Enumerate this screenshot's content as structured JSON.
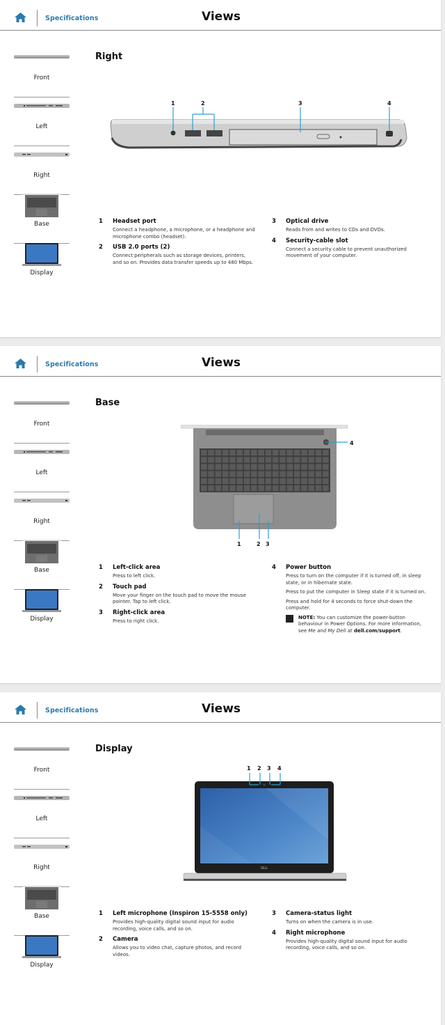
{
  "header": {
    "breadcrumb": "Specifications",
    "title": "Views",
    "home_icon": "home-icon",
    "accent_color": "#2a7bab"
  },
  "sidebar": {
    "items": [
      {
        "label": "Front",
        "thumb": "front-view-thumbnail"
      },
      {
        "label": "Left",
        "thumb": "left-view-thumbnail"
      },
      {
        "label": "Right",
        "thumb": "right-view-thumbnail"
      },
      {
        "label": "Base",
        "thumb": "base-view-thumbnail"
      },
      {
        "label": "Display",
        "thumb": "display-view-thumbnail"
      }
    ]
  },
  "pages": [
    {
      "section": "Right",
      "callouts": [
        "1",
        "2",
        "3",
        "4"
      ],
      "entries": [
        {
          "num": "1",
          "name": "Headset port",
          "desc": [
            "Connect a headphone, a microphone, or a headphone and microphone combo (headset)."
          ]
        },
        {
          "num": "2",
          "name": "USB 2.0 ports (2)",
          "desc": [
            "Connect peripherals such as storage devices, printers, and so on. Provides data transfer speeds up to 480 Mbps."
          ]
        },
        {
          "num": "3",
          "name": "Optical drive",
          "desc": [
            "Reads from and writes to CDs and DVDs."
          ]
        },
        {
          "num": "4",
          "name": "Security-cable slot",
          "desc": [
            "Connect a security cable to prevent unauthorized movement of your computer."
          ]
        }
      ]
    },
    {
      "section": "Base",
      "callouts": [
        "1",
        "2",
        "3",
        "4"
      ],
      "entries": [
        {
          "num": "1",
          "name": "Left-click area",
          "desc": [
            "Press to left click."
          ]
        },
        {
          "num": "2",
          "name": "Touch pad",
          "desc": [
            "Move your finger on the touch pad to move the mouse pointer. Tap to left click."
          ]
        },
        {
          "num": "3",
          "name": "Right-click area",
          "desc": [
            "Press to right click."
          ]
        },
        {
          "num": "4",
          "name": "Power button",
          "desc": [
            "Press to turn on the computer if it is turned off, in sleep state, or in hibernate state.",
            "Press to put the computer in Sleep state if it is turned on.",
            "Press and hold for 4 seconds to force shut-down the computer."
          ],
          "note": {
            "label": "NOTE:",
            "text_a": " You can customize the power-button behaviour in Power Options. For more information, see ",
            "italic": "Me and My Dell",
            "text_b": " at ",
            "link": "dell.com/support",
            "end": "."
          }
        }
      ]
    },
    {
      "section": "Display",
      "callouts": [
        "1",
        "2",
        "3",
        "4"
      ],
      "logo": "DELL",
      "entries": [
        {
          "num": "1",
          "name": "Left microphone (Inspiron 15-5558 only)",
          "desc": [
            "Provides high-quality digital sound input for audio recording, voice calls, and so on."
          ]
        },
        {
          "num": "2",
          "name": "Camera",
          "desc": [
            "Allows you to video chat, capture photos, and record videos."
          ]
        },
        {
          "num": "3",
          "name": "Camera-status light",
          "desc": [
            "Turns on when the camera is in use."
          ]
        },
        {
          "num": "4",
          "name": "Right microphone",
          "desc": [
            "Provides high-quality digital sound input for audio recording, voice calls, and so on."
          ]
        }
      ]
    }
  ]
}
